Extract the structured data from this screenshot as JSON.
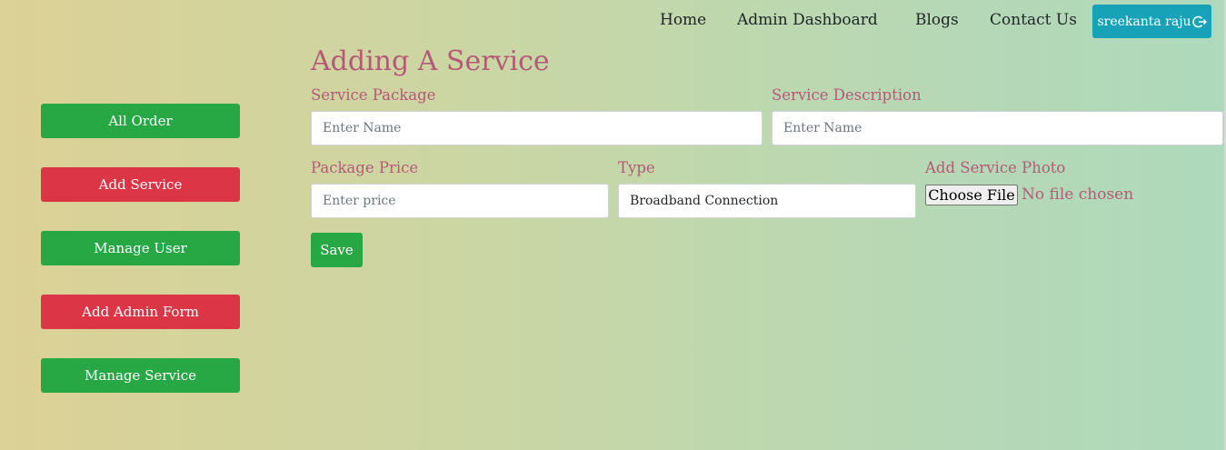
{
  "nav": {
    "links": [
      "Home",
      "Admin Dashboard",
      "Blogs",
      "Contact Us"
    ],
    "user_label": "sreekanta raju",
    "user_icon": "logout-icon"
  },
  "sidebar": {
    "items": [
      {
        "label": "All Order",
        "color": "#28a745"
      },
      {
        "label": "Add Service",
        "color": "#dc3545"
      },
      {
        "label": "Manage User",
        "color": "#28a745"
      },
      {
        "label": "Add Admin Form",
        "color": "#dc3545"
      },
      {
        "label": "Manage Service",
        "color": "#28a745"
      }
    ]
  },
  "form": {
    "title": "Adding A Service",
    "service_package": {
      "label": "Service Package",
      "placeholder": "Enter Name",
      "value": ""
    },
    "service_description": {
      "label": "Service Description",
      "placeholder": "Enter Name",
      "value": ""
    },
    "package_price": {
      "label": "Package Price",
      "placeholder": "Enter price",
      "value": ""
    },
    "type": {
      "label": "Type",
      "value": "Broadband Connection"
    },
    "photo": {
      "label": "Add Service Photo",
      "button": "Choose File",
      "status": "No file chosen"
    },
    "save_label": "Save"
  },
  "colors": {
    "accent_text": "#b45a78",
    "success": "#28a745",
    "danger": "#dc3545",
    "info": "#17a2b8"
  }
}
